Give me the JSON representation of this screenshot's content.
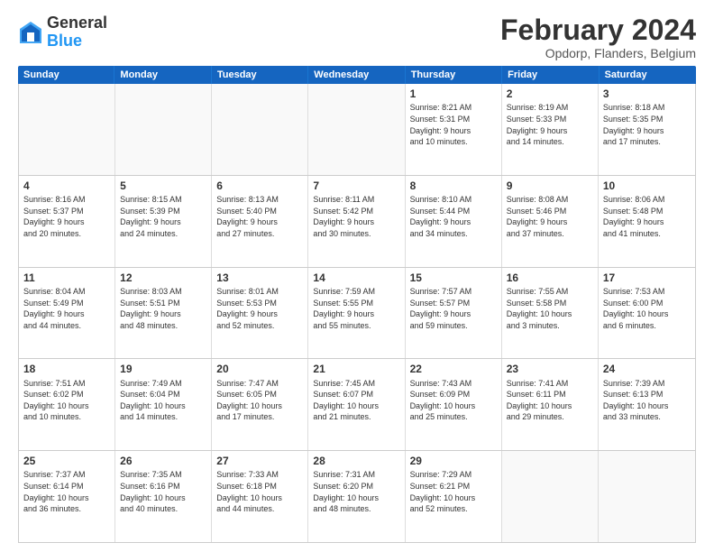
{
  "logo": {
    "general": "General",
    "blue": "Blue"
  },
  "title": "February 2024",
  "subtitle": "Opdorp, Flanders, Belgium",
  "days": [
    "Sunday",
    "Monday",
    "Tuesday",
    "Wednesday",
    "Thursday",
    "Friday",
    "Saturday"
  ],
  "weeks": [
    [
      {
        "day": "",
        "text": ""
      },
      {
        "day": "",
        "text": ""
      },
      {
        "day": "",
        "text": ""
      },
      {
        "day": "",
        "text": ""
      },
      {
        "day": "1",
        "text": "Sunrise: 8:21 AM\nSunset: 5:31 PM\nDaylight: 9 hours\nand 10 minutes."
      },
      {
        "day": "2",
        "text": "Sunrise: 8:19 AM\nSunset: 5:33 PM\nDaylight: 9 hours\nand 14 minutes."
      },
      {
        "day": "3",
        "text": "Sunrise: 8:18 AM\nSunset: 5:35 PM\nDaylight: 9 hours\nand 17 minutes."
      }
    ],
    [
      {
        "day": "4",
        "text": "Sunrise: 8:16 AM\nSunset: 5:37 PM\nDaylight: 9 hours\nand 20 minutes."
      },
      {
        "day": "5",
        "text": "Sunrise: 8:15 AM\nSunset: 5:39 PM\nDaylight: 9 hours\nand 24 minutes."
      },
      {
        "day": "6",
        "text": "Sunrise: 8:13 AM\nSunset: 5:40 PM\nDaylight: 9 hours\nand 27 minutes."
      },
      {
        "day": "7",
        "text": "Sunrise: 8:11 AM\nSunset: 5:42 PM\nDaylight: 9 hours\nand 30 minutes."
      },
      {
        "day": "8",
        "text": "Sunrise: 8:10 AM\nSunset: 5:44 PM\nDaylight: 9 hours\nand 34 minutes."
      },
      {
        "day": "9",
        "text": "Sunrise: 8:08 AM\nSunset: 5:46 PM\nDaylight: 9 hours\nand 37 minutes."
      },
      {
        "day": "10",
        "text": "Sunrise: 8:06 AM\nSunset: 5:48 PM\nDaylight: 9 hours\nand 41 minutes."
      }
    ],
    [
      {
        "day": "11",
        "text": "Sunrise: 8:04 AM\nSunset: 5:49 PM\nDaylight: 9 hours\nand 44 minutes."
      },
      {
        "day": "12",
        "text": "Sunrise: 8:03 AM\nSunset: 5:51 PM\nDaylight: 9 hours\nand 48 minutes."
      },
      {
        "day": "13",
        "text": "Sunrise: 8:01 AM\nSunset: 5:53 PM\nDaylight: 9 hours\nand 52 minutes."
      },
      {
        "day": "14",
        "text": "Sunrise: 7:59 AM\nSunset: 5:55 PM\nDaylight: 9 hours\nand 55 minutes."
      },
      {
        "day": "15",
        "text": "Sunrise: 7:57 AM\nSunset: 5:57 PM\nDaylight: 9 hours\nand 59 minutes."
      },
      {
        "day": "16",
        "text": "Sunrise: 7:55 AM\nSunset: 5:58 PM\nDaylight: 10 hours\nand 3 minutes."
      },
      {
        "day": "17",
        "text": "Sunrise: 7:53 AM\nSunset: 6:00 PM\nDaylight: 10 hours\nand 6 minutes."
      }
    ],
    [
      {
        "day": "18",
        "text": "Sunrise: 7:51 AM\nSunset: 6:02 PM\nDaylight: 10 hours\nand 10 minutes."
      },
      {
        "day": "19",
        "text": "Sunrise: 7:49 AM\nSunset: 6:04 PM\nDaylight: 10 hours\nand 14 minutes."
      },
      {
        "day": "20",
        "text": "Sunrise: 7:47 AM\nSunset: 6:05 PM\nDaylight: 10 hours\nand 17 minutes."
      },
      {
        "day": "21",
        "text": "Sunrise: 7:45 AM\nSunset: 6:07 PM\nDaylight: 10 hours\nand 21 minutes."
      },
      {
        "day": "22",
        "text": "Sunrise: 7:43 AM\nSunset: 6:09 PM\nDaylight: 10 hours\nand 25 minutes."
      },
      {
        "day": "23",
        "text": "Sunrise: 7:41 AM\nSunset: 6:11 PM\nDaylight: 10 hours\nand 29 minutes."
      },
      {
        "day": "24",
        "text": "Sunrise: 7:39 AM\nSunset: 6:13 PM\nDaylight: 10 hours\nand 33 minutes."
      }
    ],
    [
      {
        "day": "25",
        "text": "Sunrise: 7:37 AM\nSunset: 6:14 PM\nDaylight: 10 hours\nand 36 minutes."
      },
      {
        "day": "26",
        "text": "Sunrise: 7:35 AM\nSunset: 6:16 PM\nDaylight: 10 hours\nand 40 minutes."
      },
      {
        "day": "27",
        "text": "Sunrise: 7:33 AM\nSunset: 6:18 PM\nDaylight: 10 hours\nand 44 minutes."
      },
      {
        "day": "28",
        "text": "Sunrise: 7:31 AM\nSunset: 6:20 PM\nDaylight: 10 hours\nand 48 minutes."
      },
      {
        "day": "29",
        "text": "Sunrise: 7:29 AM\nSunset: 6:21 PM\nDaylight: 10 hours\nand 52 minutes."
      },
      {
        "day": "",
        "text": ""
      },
      {
        "day": "",
        "text": ""
      }
    ]
  ]
}
